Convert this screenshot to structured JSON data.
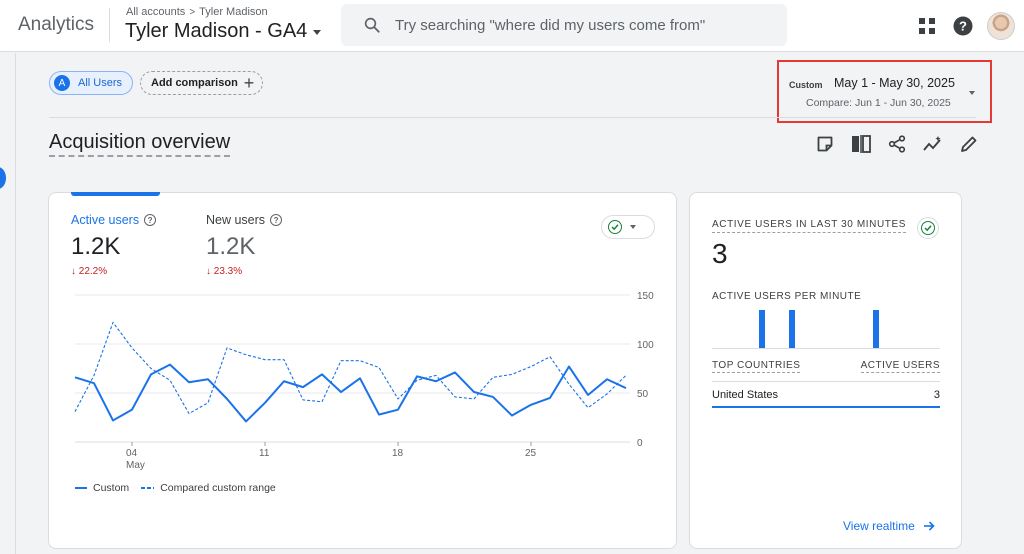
{
  "header": {
    "app_name": "Analytics",
    "breadcrumb_root": "All accounts",
    "breadcrumb_sep": ">",
    "breadcrumb_account": "Tyler Madison",
    "property": "Tyler Madison - GA4",
    "search_placeholder": "Try searching \"where did my users come from\"",
    "icons": [
      "apps-grid-icon",
      "help-icon",
      "avatar"
    ]
  },
  "comparison": {
    "segment_badge": "A",
    "segment_label": "All Users",
    "add_label": "Add comparison"
  },
  "date_range": {
    "tag": "Custom",
    "main": "May 1 - May 30, 2025",
    "compare": "Compare: Jun 1 - Jun 30, 2025"
  },
  "page": {
    "title": "Acquisition overview"
  },
  "main_card": {
    "metrics": [
      {
        "label": "Active users",
        "value": "1.2K",
        "delta": "22.2%",
        "active": true
      },
      {
        "label": "New users",
        "value": "1.2K",
        "delta": "23.3%",
        "active": false
      }
    ],
    "legend_custom": "Custom",
    "legend_compare": "Compared custom range"
  },
  "chart_data": {
    "type": "line",
    "x_ticks": [
      {
        "day": 4,
        "label": "04",
        "sublabel": "May"
      },
      {
        "day": 11,
        "label": "11",
        "sublabel": ""
      },
      {
        "day": 18,
        "label": "18",
        "sublabel": ""
      },
      {
        "day": 25,
        "label": "25",
        "sublabel": ""
      }
    ],
    "x": [
      1,
      2,
      3,
      4,
      5,
      6,
      7,
      8,
      9,
      10,
      11,
      12,
      13,
      14,
      15,
      16,
      17,
      18,
      19,
      20,
      21,
      22,
      23,
      24,
      25,
      26,
      27,
      28,
      29,
      30
    ],
    "yticks": [
      0,
      50,
      100,
      150
    ],
    "ylim": [
      0,
      150
    ],
    "series": [
      {
        "name": "Custom",
        "style": "solid",
        "color": "#1a73e8",
        "values": [
          66,
          60,
          22,
          33,
          69,
          79,
          61,
          64,
          44,
          21,
          40,
          62,
          56,
          69,
          51,
          65,
          28,
          33,
          67,
          62,
          71,
          51,
          46,
          27,
          38,
          45,
          77,
          48,
          64,
          55
        ]
      },
      {
        "name": "Compared custom range",
        "style": "dashed",
        "color": "#1a73e8",
        "values": [
          31,
          68,
          122,
          96,
          75,
          63,
          29,
          40,
          96,
          89,
          84,
          84,
          43,
          41,
          83,
          83,
          76,
          44,
          63,
          68,
          46,
          44,
          66,
          69,
          77,
          87,
          59,
          35,
          49,
          68
        ]
      }
    ]
  },
  "realtime": {
    "title": "ACTIVE USERS IN LAST 30 MINUTES",
    "value": "3",
    "per_minute_label": "ACTIVE USERS PER MINUTE",
    "per_minute_values": [
      0,
      0,
      0,
      0,
      0,
      0,
      1,
      0,
      0,
      0,
      1,
      0,
      0,
      0,
      0,
      0,
      0,
      0,
      0,
      0,
      0,
      1,
      0,
      0,
      0,
      0,
      0,
      0,
      0,
      0
    ],
    "col_country": "TOP COUNTRIES",
    "col_users": "ACTIVE USERS",
    "rows": [
      {
        "country": "United States",
        "users": "3"
      }
    ],
    "link": "View realtime"
  }
}
